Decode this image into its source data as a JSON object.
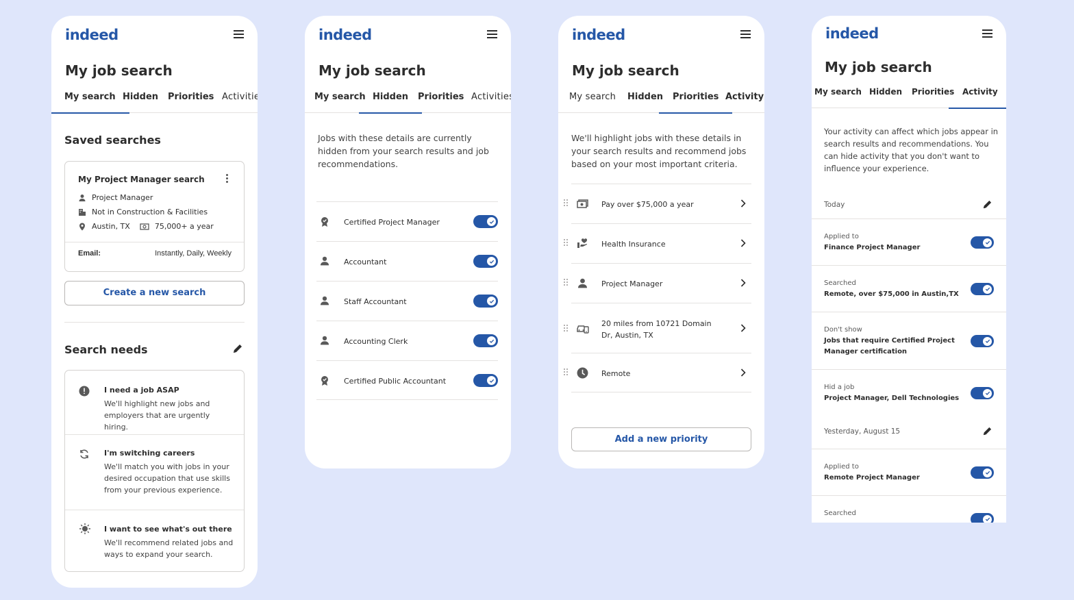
{
  "brand": {
    "logo": "indeed",
    "color": "#2557a7"
  },
  "screens": {
    "my_search": {
      "title": "My job search",
      "tabs": [
        "My search",
        "Hidden",
        "Priorities",
        "Activitie"
      ],
      "saved_title": "Saved searches",
      "card": {
        "title": "My Project Manager search",
        "job": "Project Manager",
        "industry": "Not in Construction & Facilities",
        "location": "Austin, TX",
        "salary": "75,000+ a year",
        "email_label": "Email:",
        "email_value": "Instantly, Daily, Weekly"
      },
      "create_button": "Create a new search",
      "needs_title": "Search needs",
      "needs": [
        {
          "icon": "alert-icon",
          "title": "I need a job ASAP",
          "desc": "We'll highlight new jobs and employers that are urgently hiring."
        },
        {
          "icon": "refresh-icon",
          "title": "I'm switching careers",
          "desc": "We'll match you with jobs in your desired occupation that use skills from your previous experience."
        },
        {
          "icon": "lightbulb-icon",
          "title": "I want to see what's out there",
          "desc": "We'll recommend related jobs and ways to expand your search."
        }
      ]
    },
    "hidden": {
      "title": "My job search",
      "tabs": [
        "My search",
        "Hidden",
        "Priorities",
        "Activities"
      ],
      "intro": "Jobs with these details are currently hidden from your search results and job recommendations.",
      "items": [
        {
          "icon": "certificate-icon",
          "label": "Certified Project Manager",
          "on": true
        },
        {
          "icon": "person-icon",
          "label": "Accountant",
          "on": true
        },
        {
          "icon": "person-icon",
          "label": "Staff Accountant",
          "on": true
        },
        {
          "icon": "person-icon",
          "label": "Accounting Clerk",
          "on": true
        },
        {
          "icon": "certificate-icon",
          "label": "Certified Public Accountant",
          "on": true
        }
      ]
    },
    "priorities": {
      "title": "My job search",
      "tabs": [
        "My search",
        "Hidden",
        "Priorities",
        "Activity"
      ],
      "intro": "We'll highlight jobs with these details in your search results and recommend jobs based on your most important criteria.",
      "items": [
        {
          "icon": "money-icon",
          "label": "Pay over $75,000 a year"
        },
        {
          "icon": "health-icon",
          "label": "Health Insurance"
        },
        {
          "icon": "person-icon",
          "label": "Project Manager"
        },
        {
          "icon": "commute-icon",
          "label": "20 miles from 10721 Domain Dr, Austin, TX"
        },
        {
          "icon": "clock-icon",
          "label": "Remote"
        }
      ],
      "add_button": "Add a new priority"
    },
    "activity": {
      "title": "My job search",
      "tabs": [
        "My search",
        "Hidden",
        "Priorities",
        "Activity"
      ],
      "intro": "Your activity can affect which jobs appear in search results and recommendations. You can hide activity that you don't want to influence your experience.",
      "groups": [
        {
          "date": "Today",
          "items": [
            {
              "label": "Applied to",
              "value": "Finance Project Manager"
            },
            {
              "label": "Searched",
              "value": "Remote, over $75,000 in Austin,TX"
            },
            {
              "label": "Don't show",
              "value": "Jobs that require Certified Project Manager certification"
            },
            {
              "label": "Hid a job",
              "value": "Project Manager, Dell Technologies"
            }
          ]
        },
        {
          "date": "Yesterday, August 15",
          "items": [
            {
              "label": "Applied to",
              "value": "Remote Project Manager"
            },
            {
              "label": "Searched",
              "value": ""
            }
          ]
        }
      ]
    }
  }
}
